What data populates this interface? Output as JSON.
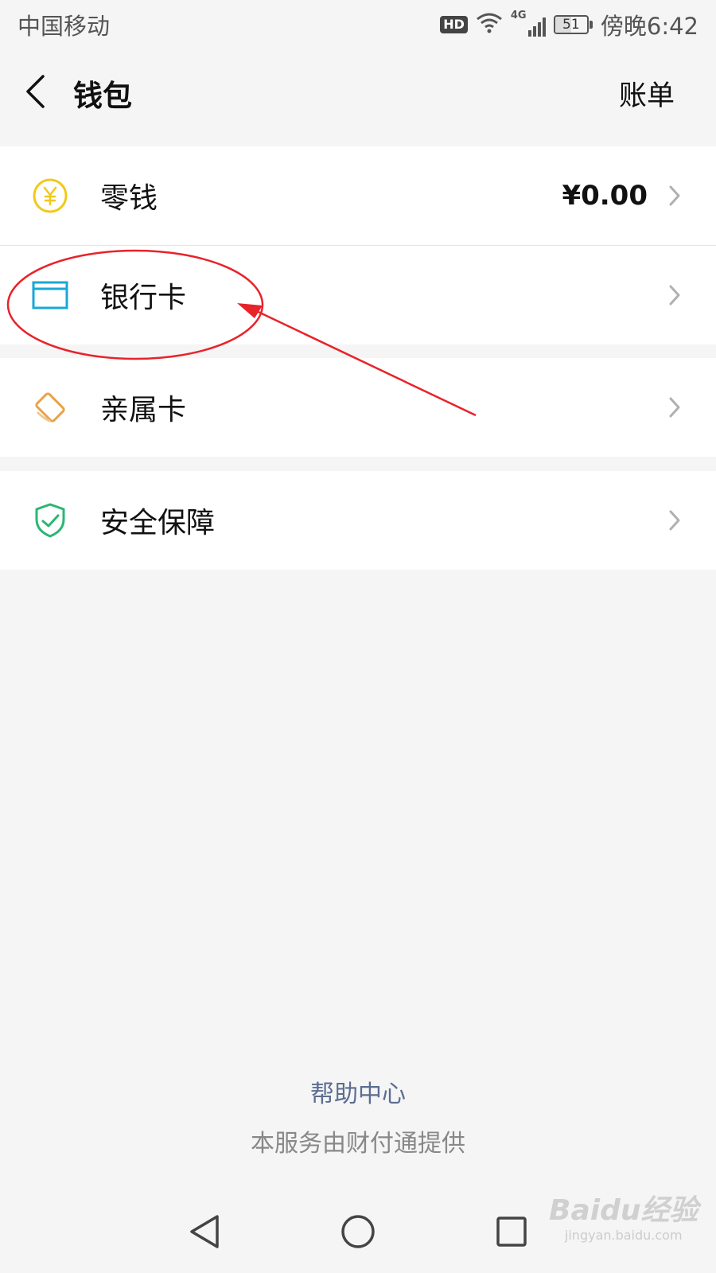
{
  "status_bar": {
    "carrier": "中国移动",
    "hd": "HD",
    "network": "4G",
    "battery": "51",
    "battery_level": 0.51,
    "time": "傍晚6:42"
  },
  "nav": {
    "title": "钱包",
    "right_action": "账单"
  },
  "groups": [
    {
      "items": [
        {
          "label": "零钱",
          "value": "¥0.00",
          "icon": "coin-yen-icon",
          "color": "#f2c81b"
        },
        {
          "label": "银行卡",
          "value": "",
          "icon": "bank-card-icon",
          "color": "#1aa7d8"
        }
      ]
    },
    {
      "items": [
        {
          "label": "亲属卡",
          "value": "",
          "icon": "family-card-icon",
          "color": "#e8a24a"
        }
      ]
    },
    {
      "items": [
        {
          "label": "安全保障",
          "value": "",
          "icon": "shield-check-icon",
          "color": "#2bb673"
        }
      ]
    }
  ],
  "footer": {
    "help": "帮助中心",
    "provider": "本服务由财付通提供"
  },
  "watermark": {
    "brand": "Baidu经验",
    "url": "jingyan.baidu.com"
  },
  "colors": {
    "annotation": "#e8232a",
    "link": "#5b6d91",
    "background": "#f5f5f5"
  }
}
